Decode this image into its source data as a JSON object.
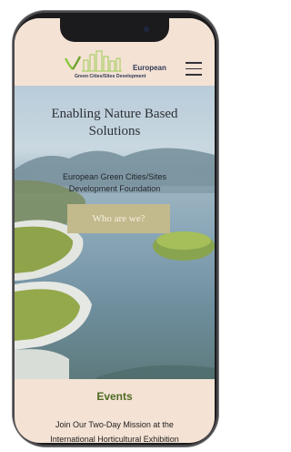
{
  "header": {
    "logo_name": "European",
    "logo_subtitle": "Green Cities/Sites Development"
  },
  "hero": {
    "title_line1": "Enabling Nature Based",
    "title_line2": "Solutions",
    "subtitle_line1": "European Green Cities/Sites",
    "subtitle_line2": "Development Foundation",
    "cta_label": "Who are we?"
  },
  "events": {
    "title": "Events",
    "text_line1": "Join Our Two-Day Mission at the",
    "text_line2": "International Horticultural Exhibition"
  },
  "colors": {
    "header_bg": "#f4e2d4",
    "brand_text": "#2f3a57",
    "logo_green": "#8cc63f",
    "cta_bg": "#c2b98c",
    "events_title": "#4f6a24"
  },
  "icons": {
    "menu": "hamburger-icon",
    "logo": "city-skyline-logo"
  }
}
